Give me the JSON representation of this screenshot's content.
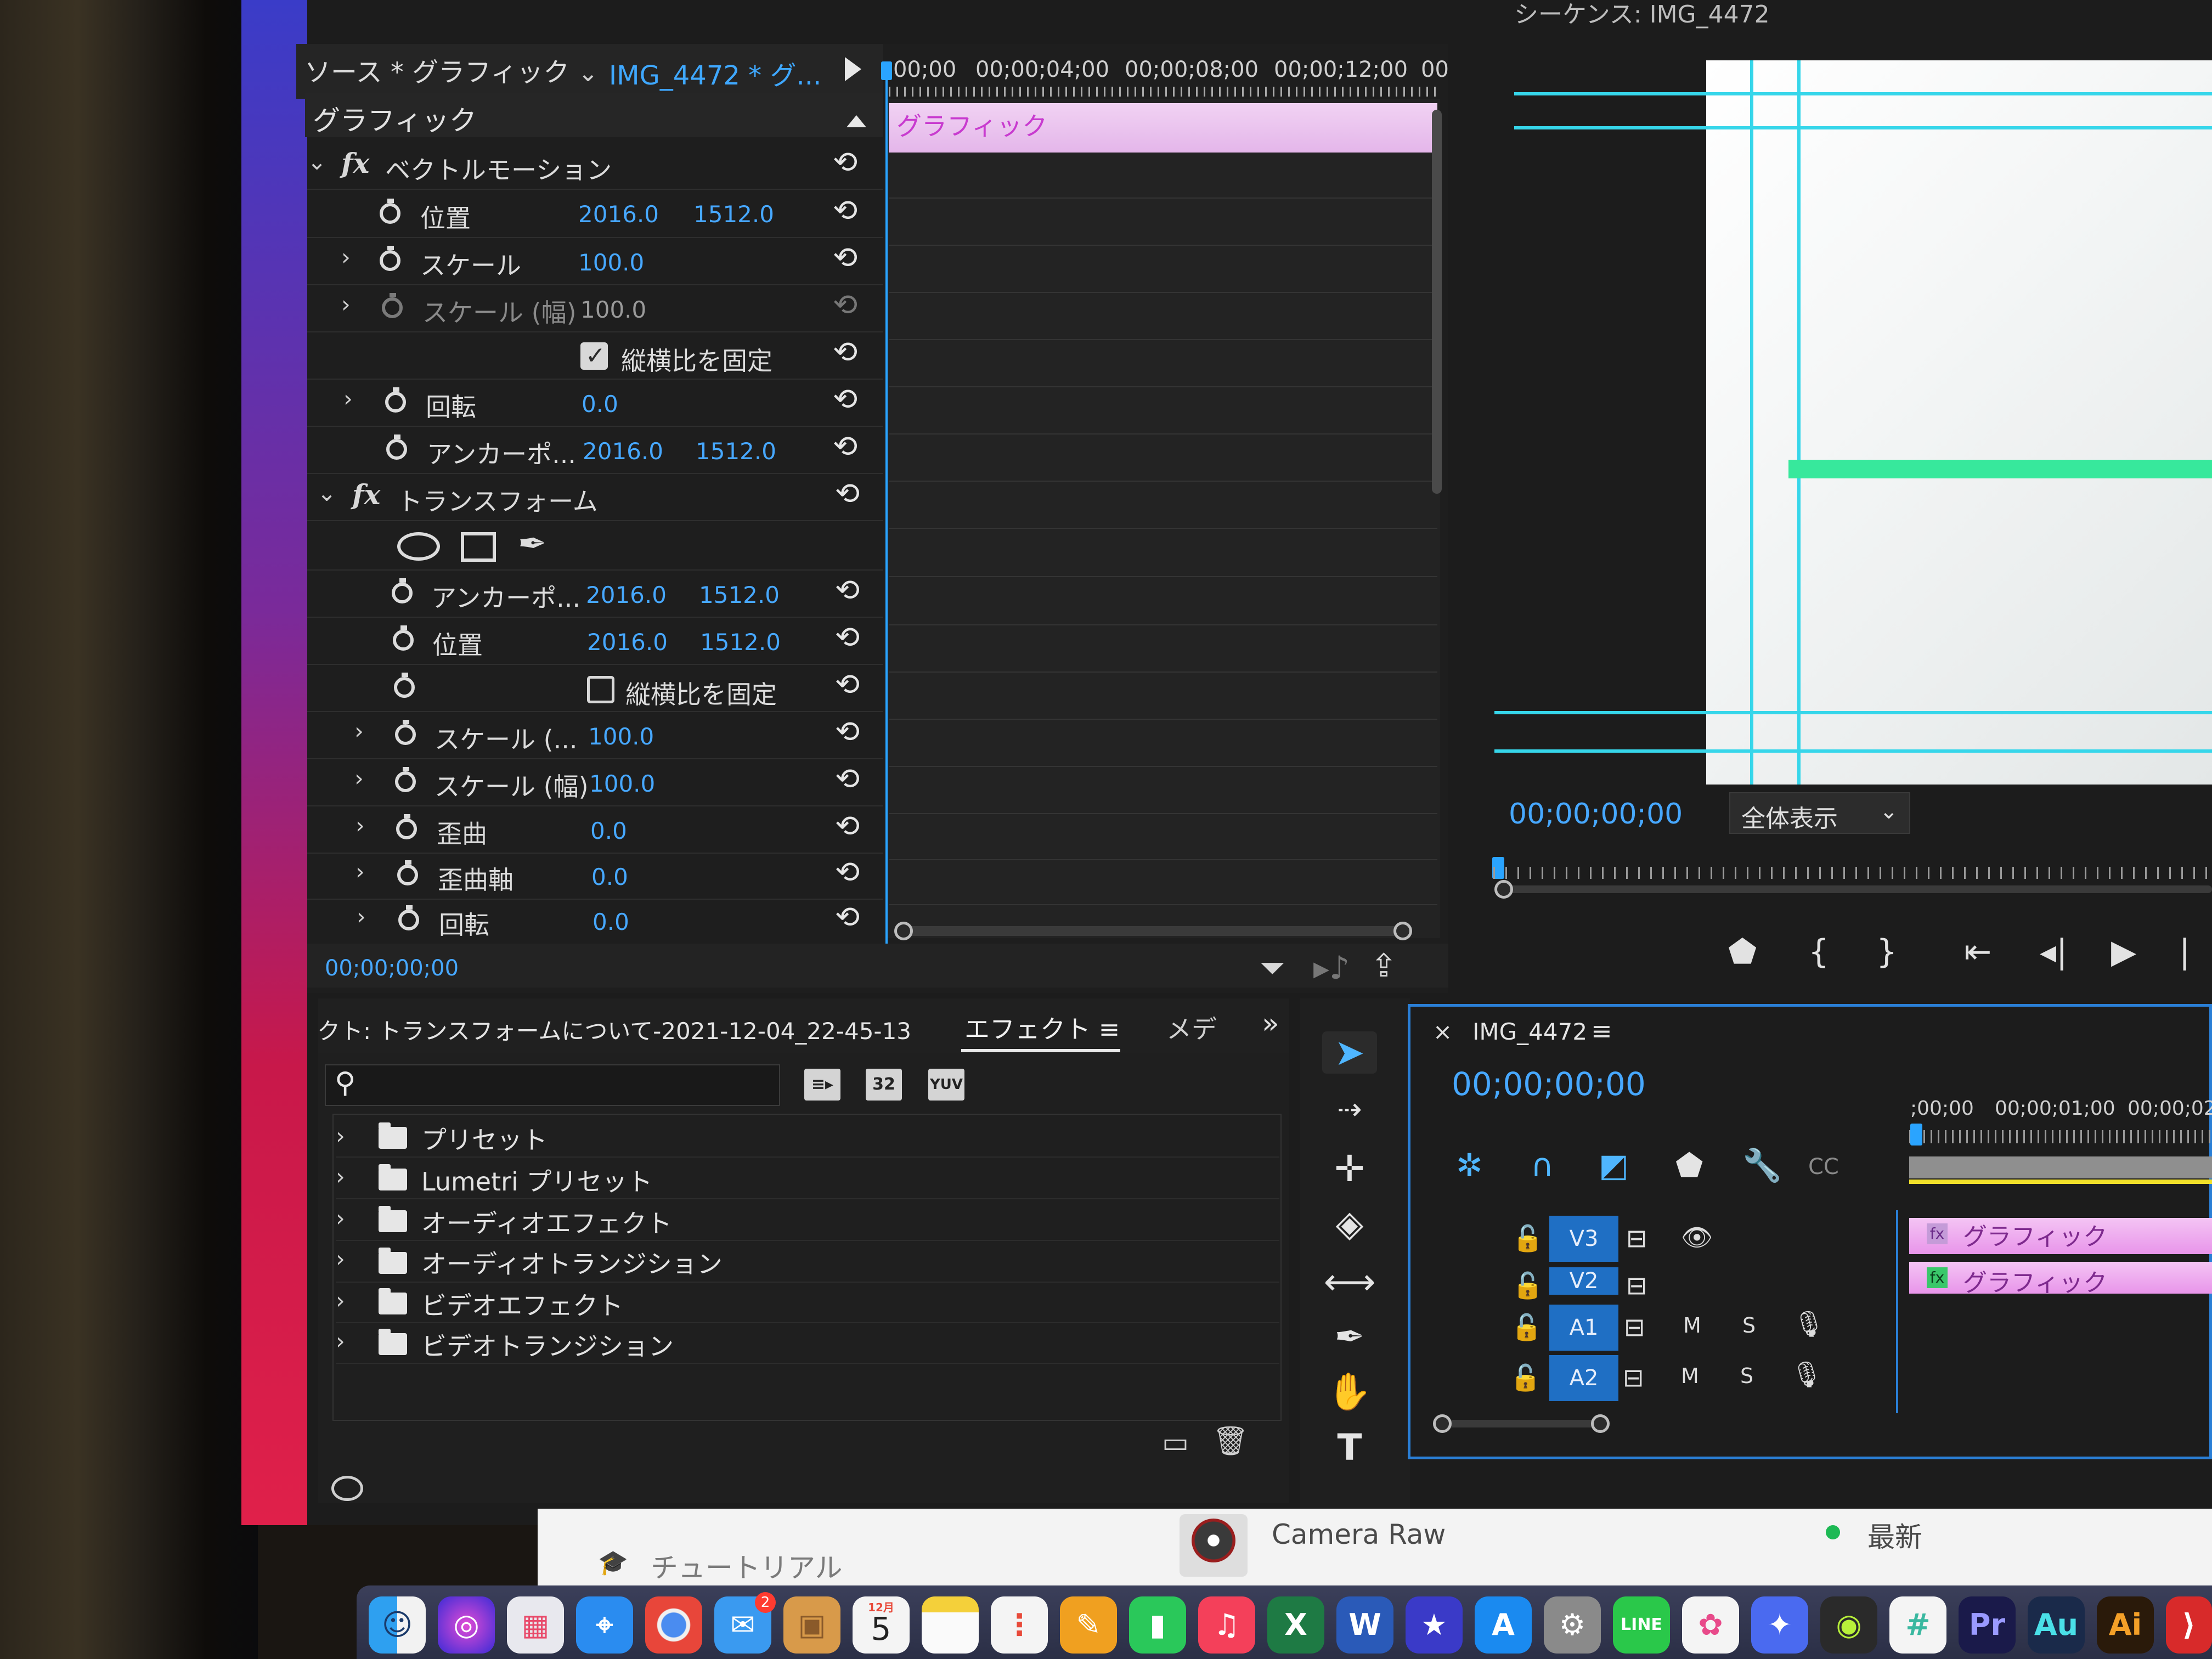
{
  "source_panel": {
    "source_label": "ソース * グラフィック",
    "sequence_label": "IMG_4472 * グ...",
    "section_title": "グラフィック",
    "timecode": "00;00;00;00",
    "ruler": [
      "00;00",
      "00;00;04;00",
      "00;00;08;00",
      "00;00;12;00",
      "00"
    ],
    "clip_label": "グラフィック",
    "vector_motion": {
      "title": "ベクトルモーション",
      "rows": [
        {
          "label": "位置",
          "v1": "2016.0",
          "v2": "1512.0"
        },
        {
          "label": "スケール",
          "v1": "100.0",
          "v2": ""
        },
        {
          "label": "スケール (幅)",
          "v1": "100.0",
          "v2": ""
        },
        {
          "label": "縦横比を固定",
          "v1": "",
          "v2": ""
        },
        {
          "label": "回転",
          "v1": "0.0",
          "v2": ""
        },
        {
          "label": "アンカーポ...",
          "v1": "2016.0",
          "v2": "1512.0"
        }
      ]
    },
    "transform": {
      "title": "トランスフォーム",
      "rows": [
        {
          "label": "アンカーポ...",
          "v1": "2016.0",
          "v2": "1512.0"
        },
        {
          "label": "位置",
          "v1": "2016.0",
          "v2": "1512.0"
        },
        {
          "label": "縦横比を固定",
          "v1": "",
          "v2": ""
        },
        {
          "label": "スケール (...",
          "v1": "100.0",
          "v2": ""
        },
        {
          "label": "スケール (幅)",
          "v1": "100.0",
          "v2": ""
        },
        {
          "label": "歪曲",
          "v1": "0.0",
          "v2": ""
        },
        {
          "label": "歪曲軸",
          "v1": "0.0",
          "v2": ""
        },
        {
          "label": "回転",
          "v1": "0.0",
          "v2": ""
        }
      ]
    }
  },
  "program_panel": {
    "title": "シーケンス: IMG_4472",
    "timecode": "00;00;00;00",
    "zoom": "全体表示"
  },
  "effects_panel": {
    "project_tab": "クト: トランスフォームについて-2021-12-04_22-45-13",
    "effects_tab": "エフェクト",
    "meta_tab": "メデ",
    "buttons": [
      "32",
      "YUV"
    ],
    "tree": [
      "プリセット",
      "Lumetri プリセット",
      "オーディオエフェクト",
      "オーディオトランジション",
      "ビデオエフェクト",
      "ビデオトランジション"
    ]
  },
  "timeline_panel": {
    "title": "IMG_4472",
    "timecode": "00;00;00;00",
    "ruler": [
      ";00;00",
      "00;00;01;00",
      "00;00;02;"
    ],
    "tracks": [
      {
        "name": "V3",
        "clip": "グラフィック"
      },
      {
        "name": "V2",
        "clip": "グラフィック"
      },
      {
        "name": "A1",
        "clip": ""
      },
      {
        "name": "A2",
        "clip": ""
      }
    ],
    "audio_buttons": {
      "m": "M",
      "s": "S"
    }
  },
  "bottom_strip": {
    "tutorial": "チュートリアル",
    "camera_raw": "Camera Raw",
    "status": "最新"
  },
  "dock": {
    "calendar_month": "12月",
    "calendar_day": "5",
    "mail_badge": "2",
    "apps": [
      "Pr",
      "Au",
      "Ai"
    ]
  },
  "colors": {
    "accent_blue": "#47a8ff",
    "clip_pink": "#e895ea",
    "guide_cyan": "#36d6ea",
    "track_blue": "#1f6fc4"
  }
}
